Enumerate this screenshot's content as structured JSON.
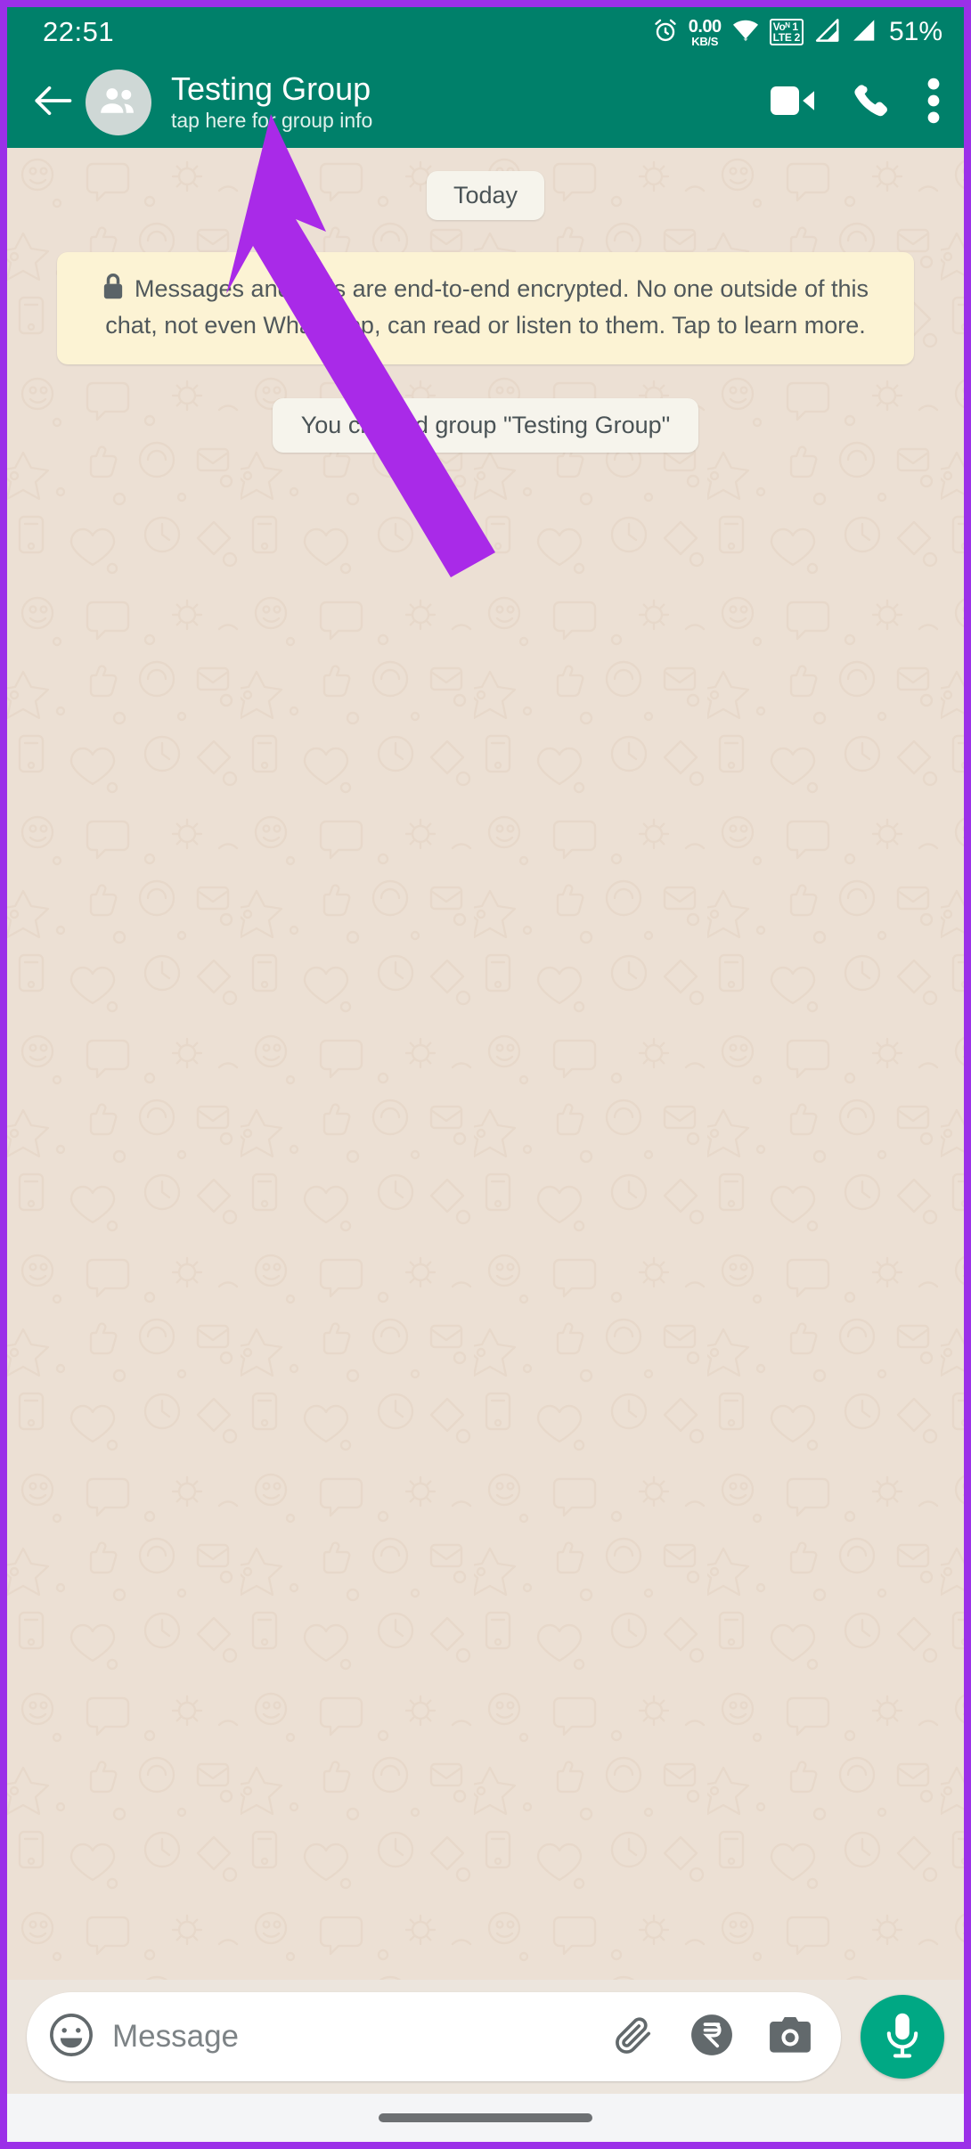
{
  "status_bar": {
    "time": "22:51",
    "alarm_icon": "alarm-clock-icon",
    "net_speed_value": "0.00",
    "net_speed_unit": "KB/S",
    "wifi_icon": "wifi-icon",
    "volte_line1": "Voᴺ 1",
    "volte_line2": "LTE 2",
    "signal_icon_1": "signal-bars-sim1-icon",
    "signal_icon_2": "signal-bars-sim2-icon",
    "battery_percent": "51%"
  },
  "app_bar": {
    "back_icon": "back-arrow-icon",
    "avatar_icon": "group-avatar-icon",
    "title": "Testing Group",
    "subtitle": "tap here for group info",
    "video_call_icon": "video-call-icon",
    "voice_call_icon": "phone-call-icon",
    "overflow_icon": "more-vertical-icon"
  },
  "chat": {
    "date_divider": "Today",
    "lock_icon": "lock-icon",
    "encryption_notice": "Messages and calls are end-to-end encrypted. No one outside of this chat, not even WhatsApp, can read or listen to them. Tap to learn more.",
    "system_message": "You created group \"Testing Group\""
  },
  "composer": {
    "emoji_icon": "emoji-smiley-icon",
    "placeholder": "Message",
    "attach_icon": "paperclip-attach-icon",
    "payment_icon": "rupee-payment-icon",
    "camera_icon": "camera-icon",
    "mic_icon": "microphone-icon"
  },
  "nav_bar": {
    "handle": "home-gesture-handle"
  },
  "annotation": {
    "arrow_icon": "purple-pointer-arrow",
    "arrow_color": "#a92ae8",
    "frame_color": "#9b30e8"
  },
  "colors": {
    "header_green": "#00806a",
    "chat_background": "#ece0d4",
    "accent_green": "#00a884",
    "notice_yellow": "#fcf3d4",
    "bubble_white": "#f6f4ec"
  }
}
